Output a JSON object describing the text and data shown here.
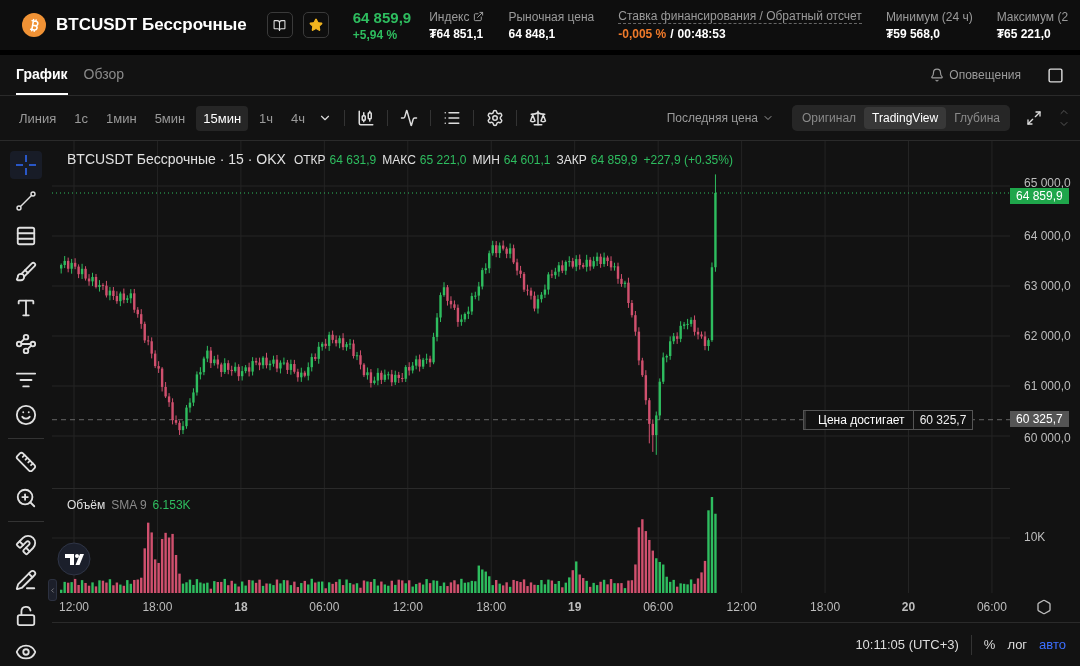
{
  "header": {
    "symbol": "BTCUSDT Бессрочные",
    "favorite": true,
    "last_price": "64 859,9",
    "change": "+5,94 %",
    "stats": [
      {
        "kind": "link",
        "label": "Индекс",
        "value": "₮64 851,1"
      },
      {
        "kind": "plain",
        "label": "Рыночная цена",
        "value": "64 848,1"
      },
      {
        "kind": "funding",
        "label": "Ставка финансирования / Обратный отсчет",
        "value": "-0,005 %",
        "separator": "/",
        "countdown": "00:48:53"
      },
      {
        "kind": "plain",
        "label": "Минимум (24 ч)",
        "value": "₮59 568,0"
      },
      {
        "kind": "plain",
        "label": "Максимум (2",
        "value": "₮65 221,0"
      }
    ]
  },
  "tabs": [
    {
      "label": "График",
      "selected": true
    },
    {
      "label": "Обзор",
      "selected": false
    }
  ],
  "alerts_button": "Оповещения",
  "intervals": [
    {
      "label": "Линия",
      "selected": false
    },
    {
      "label": "1с",
      "selected": false
    },
    {
      "label": "1мин",
      "selected": false
    },
    {
      "label": "5мин",
      "selected": false
    },
    {
      "label": "15мин",
      "selected": true
    },
    {
      "label": "1ч",
      "selected": false
    },
    {
      "label": "4ч",
      "selected": false
    }
  ],
  "price_source": "Последняя цена",
  "views": [
    {
      "label": "Оригинал",
      "selected": false
    },
    {
      "label": "TradingView",
      "selected": true
    },
    {
      "label": "Глубина",
      "selected": false
    }
  ],
  "drawing_tools": [
    {
      "kind": "crosshair",
      "selected": true
    },
    {
      "kind": "trendline",
      "selected": false
    },
    {
      "kind": "lines",
      "selected": false
    },
    {
      "kind": "brush",
      "selected": false
    },
    {
      "kind": "text",
      "selected": false
    },
    {
      "kind": "pattern",
      "selected": false
    },
    {
      "kind": "fib",
      "selected": false
    },
    {
      "kind": "emoji",
      "selected": false
    },
    {
      "kind": "divider"
    },
    {
      "kind": "ruler",
      "selected": false
    },
    {
      "kind": "zoom",
      "selected": false
    },
    {
      "kind": "divider"
    },
    {
      "kind": "magnet",
      "selected": false
    },
    {
      "kind": "pencil-lock",
      "selected": false
    },
    {
      "kind": "lock",
      "selected": false
    },
    {
      "kind": "eye",
      "selected": false
    }
  ],
  "chart": {
    "title": "BTCUSDT Бессрочные · 15 · OKX",
    "ohlc": [
      {
        "label": "ОТКР",
        "value": "64 631,9"
      },
      {
        "label": "МАКС",
        "value": "65 221,0"
      },
      {
        "label": "МИН",
        "value": "64 601,1"
      },
      {
        "label": "ЗАКР",
        "value": "64 859,9"
      }
    ],
    "change": "+227,9 (+0.35%)",
    "price_axis": [
      "65 000,0",
      "64 000,0",
      "63 000,0",
      "62 000,0",
      "61 000,0",
      "60 000,0"
    ],
    "last_price_badge": "64 859,9",
    "alert": {
      "label": "Цена достигает",
      "value": "60 325,7"
    },
    "alert_badge": "60 325,7",
    "volume": {
      "label": "Объём",
      "indicator": "SMA 9",
      "value": "6.153K",
      "axis": "10K"
    },
    "time_axis": [
      {
        "label": "12:00",
        "kind": "time"
      },
      {
        "label": "18:00",
        "kind": "time"
      },
      {
        "label": "18",
        "kind": "day"
      },
      {
        "label": "06:00",
        "kind": "time"
      },
      {
        "label": "12:00",
        "kind": "time"
      },
      {
        "label": "18:00",
        "kind": "time"
      },
      {
        "label": "19",
        "kind": "day"
      },
      {
        "label": "06:00",
        "kind": "time"
      },
      {
        "label": "12:00",
        "kind": "time"
      },
      {
        "label": "18:00",
        "kind": "time"
      },
      {
        "label": "20",
        "kind": "day"
      },
      {
        "label": "06:00",
        "kind": "time"
      }
    ]
  },
  "footer": {
    "clock": "10:11:05 (UTC+3)",
    "scale_modes": [
      {
        "label": "%",
        "selected": false
      },
      {
        "label": "лог",
        "selected": false
      },
      {
        "label": "авто",
        "selected": true
      }
    ]
  }
}
